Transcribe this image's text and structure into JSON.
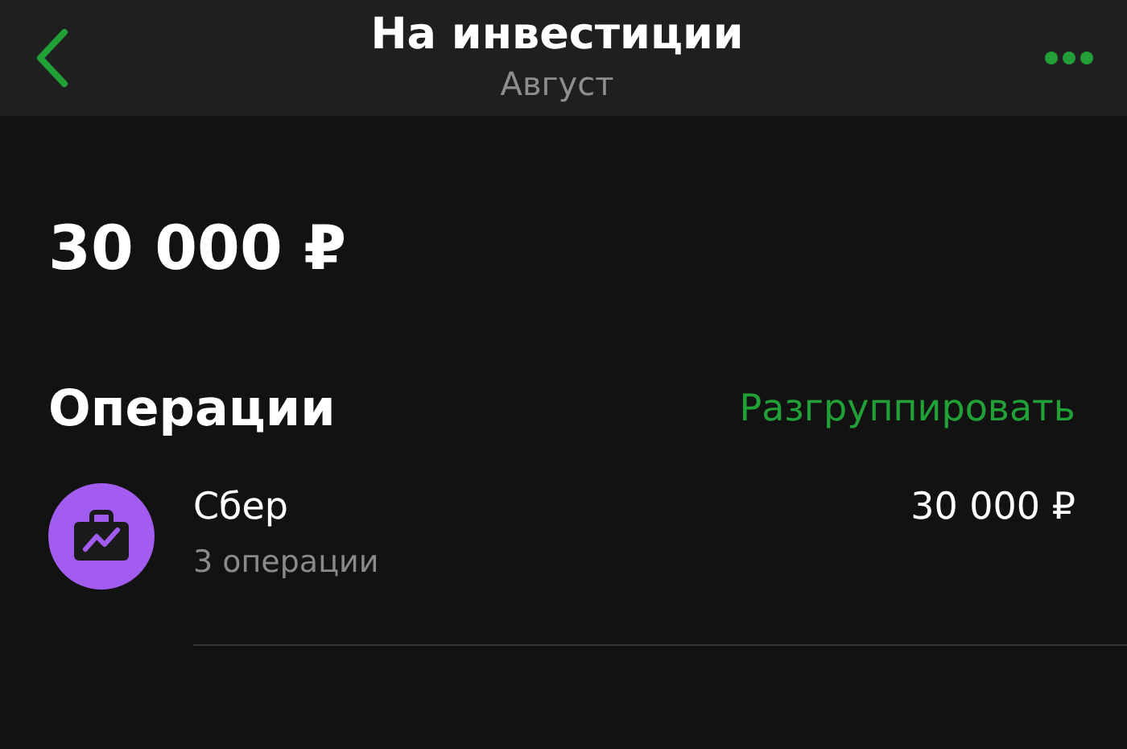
{
  "header": {
    "title": "На инвестиции",
    "subtitle": "Август"
  },
  "total": "30 000 ₽",
  "operations": {
    "title": "Операции",
    "action": "Разгруппировать",
    "items": [
      {
        "name": "Сбер",
        "count": "3 операции",
        "amount": "30 000 ₽"
      }
    ]
  }
}
